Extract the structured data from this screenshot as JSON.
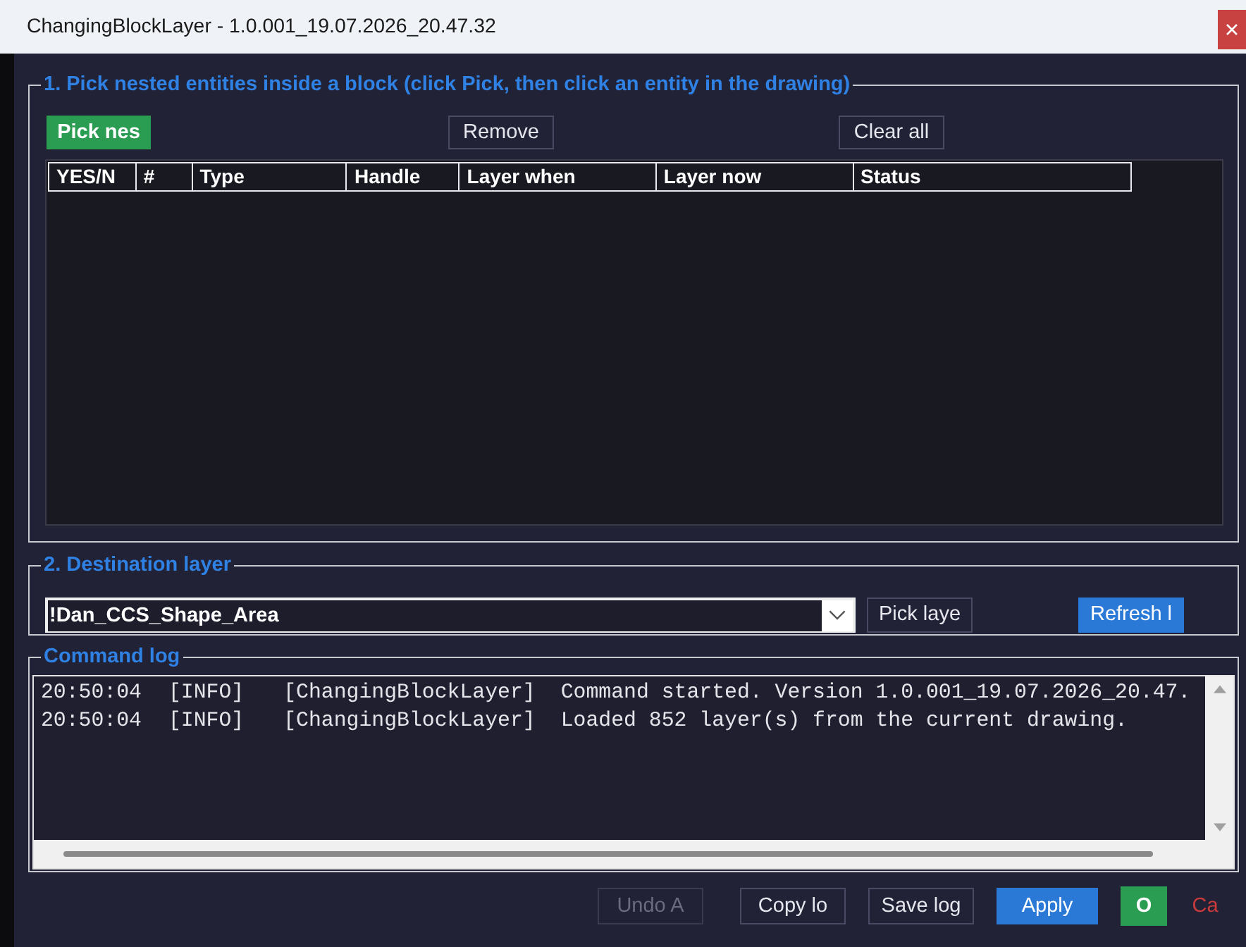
{
  "window": {
    "title": "ChangingBlockLayer - 1.0.001_19.07.2026_20.47.32"
  },
  "entities_group": {
    "legend": "1. Pick nested entities inside a block (click Pick, then click an entity in the drawing)",
    "buttons": [
      {
        "label": "Pick nes",
        "kind": "success"
      },
      {
        "label": "Remove",
        "kind": "outline"
      },
      {
        "label": "Clear all",
        "kind": "outline"
      }
    ],
    "table": {
      "columns": [
        "YES/N",
        "#",
        "Type",
        "Handle",
        "Layer when",
        "Layer now",
        "Status"
      ]
    }
  },
  "destination_group": {
    "legend": "2. Destination layer",
    "layer_select": {
      "value": "!Dan_CCS_Shape_Area"
    },
    "buttons": [
      {
        "label": "Pick laye",
        "kind": "outline"
      },
      {
        "label": "Refresh l",
        "kind": "primary"
      }
    ]
  },
  "log_group": {
    "legend": "Command log",
    "lines": [
      {
        "time": "20:50:04",
        "level": "[INFO]",
        "source": "[ChangingBlockLayer]",
        "message": "Command started. Version 1.0.001_19.07.2026_20.47."
      },
      {
        "time": "20:50:04",
        "level": "[INFO]",
        "source": "[ChangingBlockLayer]",
        "message": "Loaded 852 layer(s) from the current drawing."
      }
    ]
  },
  "footer_buttons": [
    {
      "label": "Undo A",
      "kind": "outline",
      "disabled": true
    },
    {
      "label": "Copy lo",
      "kind": "outline",
      "disabled": false
    },
    {
      "label": "Save log",
      "kind": "outline",
      "disabled": false
    },
    {
      "label": "Apply",
      "kind": "primary",
      "disabled": false
    },
    {
      "label": "O",
      "kind": "success",
      "disabled": false
    },
    {
      "label": "Ca",
      "kind": "danger-text",
      "disabled": false
    }
  ]
}
